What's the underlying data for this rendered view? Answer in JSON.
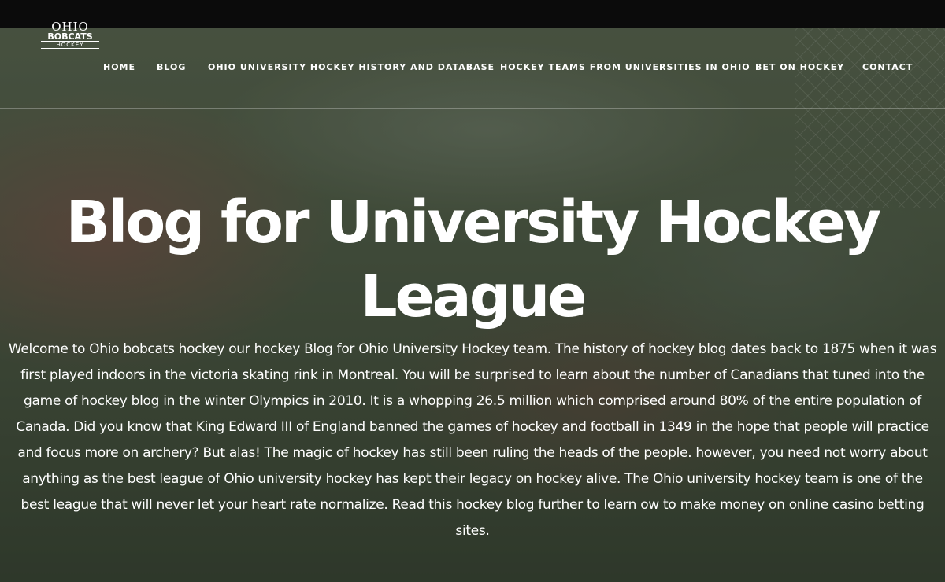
{
  "logo": {
    "top": "OHIO",
    "mid": "BOBCATS",
    "bottom": "HOCKEY"
  },
  "nav": {
    "items": [
      {
        "label": "HOME"
      },
      {
        "label": "BLOG"
      },
      {
        "label": "OHIO UNIVERSITY HOCKEY HISTORY AND DATABASE"
      },
      {
        "label": "HOCKEY TEAMS FROM UNIVERSITIES IN OHIO"
      },
      {
        "label": "BET ON HOCKEY"
      },
      {
        "label": "CONTACT"
      }
    ]
  },
  "hero": {
    "title": "Blog for University Hockey League",
    "intro": "Welcome to Ohio bobcats hockey our hockey Blog for Ohio University Hockey team. The history of hockey blog dates back to 1875 when it was first played indoors in the victoria skating rink in Montreal. You will be surprised to learn about the number of Canadians that tuned into the game of hockey blog in the winter Olympics in 2010. It is a whopping 26.5 million which comprised around 80% of the entire population of Canada. Did you know that King Edward III of England banned the games of hockey and football in 1349 in the hope that people will practice and focus more on archery? But alas! The magic of hockey has still been ruling the heads of the people. however, you need not worry about anything as the best league of Ohio university hockey has kept their legacy on hockey alive. The Ohio university hockey team is one of the best league that will never let your heart rate normalize. Read this hockey blog further to learn ow to make money on online casino betting sites."
  },
  "colors": {
    "topbar": "#0b0b0b",
    "text": "#ffffff"
  }
}
